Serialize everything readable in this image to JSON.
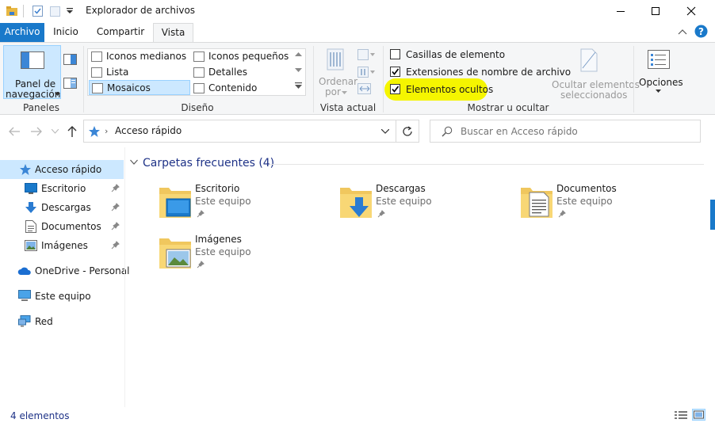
{
  "window": {
    "title": "Explorador de archivos",
    "controls": [
      "minimize-icon",
      "maximize-icon",
      "close-icon"
    ]
  },
  "tabs": {
    "archivo": "Archivo",
    "inicio": "Inicio",
    "compartir": "Compartir",
    "vista": "Vista",
    "active": "Vista"
  },
  "ribbon": {
    "paneles": {
      "nav_pane_line1": "Panel de",
      "nav_pane_line2": "navegación",
      "group_label": "Paneles"
    },
    "diseno": {
      "items": [
        "Iconos medianos",
        "Iconos pequeños",
        "Lista",
        "Detalles",
        "Mosaicos",
        "Contenido"
      ],
      "selected": "Mosaicos",
      "group_label": "Diseño"
    },
    "vista_actual": {
      "ordenar_line1": "Ordenar",
      "ordenar_line2": "por",
      "group_label": "Vista actual"
    },
    "mostrar": {
      "casillas": {
        "label": "Casillas de elemento",
        "checked": false
      },
      "extensiones": {
        "label": "Extensiones de nombre de archivo",
        "checked": true
      },
      "ocultos": {
        "label": "Elementos ocultos",
        "checked": true,
        "highlight": "#f5f500"
      },
      "ocultar_line1": "Ocultar elementos",
      "ocultar_line2": "seleccionados",
      "group_label": "Mostrar u ocultar"
    },
    "opciones": {
      "label": "Opciones"
    }
  },
  "address": {
    "location": "Acceso rápido",
    "search_placeholder": "Buscar en Acceso rápido"
  },
  "nav": {
    "quick_access": "Acceso rápido",
    "pinned": [
      {
        "label": "Escritorio",
        "icon": "desktop-icon"
      },
      {
        "label": "Descargas",
        "icon": "downloads-icon"
      },
      {
        "label": "Documentos",
        "icon": "documents-icon"
      },
      {
        "label": "Imágenes",
        "icon": "pictures-icon"
      }
    ],
    "onedrive": "OneDrive - Personal",
    "este_equipo": "Este equipo",
    "red": "Red"
  },
  "content": {
    "group_title": "Carpetas frecuentes (4)",
    "folders": [
      {
        "name": "Escritorio",
        "location": "Este equipo",
        "icon": "desktop-folder-icon"
      },
      {
        "name": "Descargas",
        "location": "Este equipo",
        "icon": "downloads-folder-icon"
      },
      {
        "name": "Documentos",
        "location": "Este equipo",
        "icon": "documents-folder-icon"
      },
      {
        "name": "Imágenes",
        "location": "Este equipo",
        "icon": "pictures-folder-icon"
      }
    ]
  },
  "status": {
    "count": "4 elementos"
  },
  "colors": {
    "accent": "#1979ca",
    "selection": "#cce8ff",
    "header_text": "#1e3287",
    "highlight": "#f5f500"
  }
}
